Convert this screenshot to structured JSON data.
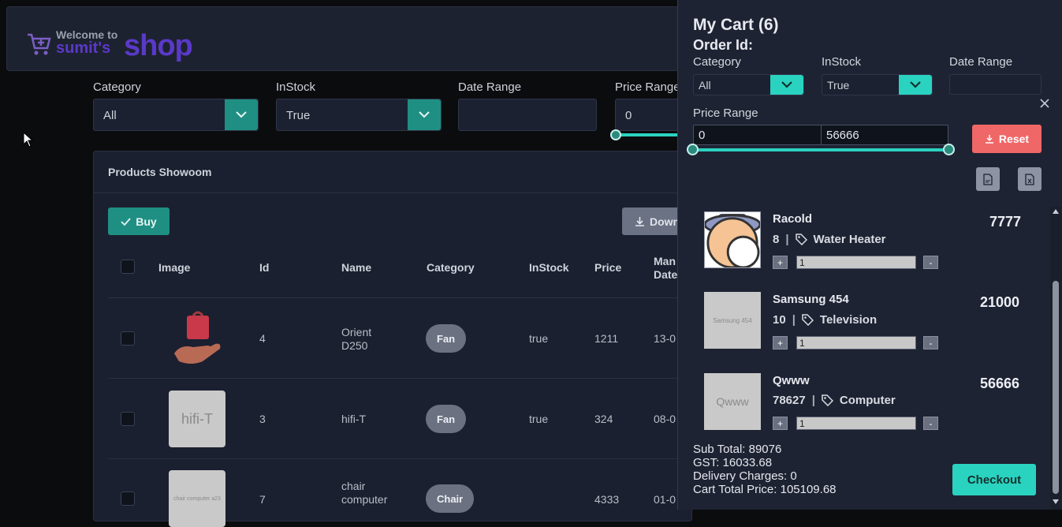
{
  "header": {
    "welcome": "Welcome to",
    "brand_name": "sumit's",
    "brand_shop": "shop"
  },
  "filters": {
    "category_label": "Category",
    "category_value": "All",
    "instock_label": "InStock",
    "instock_value": "True",
    "date_label": "Date Range",
    "date_value": "",
    "price_label": "Price Range",
    "price_min": "0"
  },
  "products": {
    "title": "Products Showoom",
    "buy_label": "Buy",
    "download_label": "Down",
    "columns": [
      "Image",
      "Id",
      "Name",
      "Category",
      "InStock",
      "Price",
      "Man",
      "Date"
    ],
    "rows": [
      {
        "id": "4",
        "name_line1": "Orient",
        "name_line2": "D250",
        "category": "Fan",
        "instock": "true",
        "price": "1211",
        "date": "13-0"
      },
      {
        "id": "3",
        "name_line1": "hifi-T",
        "name_line2": "",
        "category": "Fan",
        "instock": "true",
        "price": "324",
        "date": "08-0",
        "thumb_text": "hifi-T"
      },
      {
        "id": "7",
        "name_line1": "chair",
        "name_line2": "computer",
        "category": "Chair",
        "instock": "",
        "price": "4333",
        "date": "01-0",
        "thumb_text": "chair computer a23"
      }
    ]
  },
  "cart": {
    "title": "My Cart (6)",
    "order_id_label": "Order Id:",
    "category_label": "Category",
    "category_value": "All",
    "instock_label": "InStock",
    "instock_value": "True",
    "date_label": "Date Range",
    "date_value": "",
    "price_label": "Price Range",
    "price_min": "0",
    "price_max": "56666",
    "reset_label": "Reset",
    "items": [
      {
        "name": "Racold",
        "qty_stock": "8",
        "category": "Water Heater",
        "price": "7777",
        "quantity": "1"
      },
      {
        "name": "Samsung 454",
        "qty_stock": "10",
        "category": "Television",
        "price": "21000",
        "quantity": "1",
        "thumb_text": "Samsung 454"
      },
      {
        "name": "Qwww",
        "qty_stock": "78627",
        "category": "Computer",
        "price": "56666",
        "quantity": "1",
        "thumb_text": "Qwww"
      }
    ],
    "sub_total": "Sub Total: 89076",
    "gst": "GST: 16033.68",
    "delivery": "Delivery Charges: 0",
    "total": "Cart Total Price: 105109.68",
    "checkout_label": "Checkout"
  },
  "colors": {
    "accent_teal": "#2ad2c0",
    "teal_dark": "#1f8f83",
    "reset_red": "#f06767",
    "brand_purple": "#5a39c8"
  }
}
